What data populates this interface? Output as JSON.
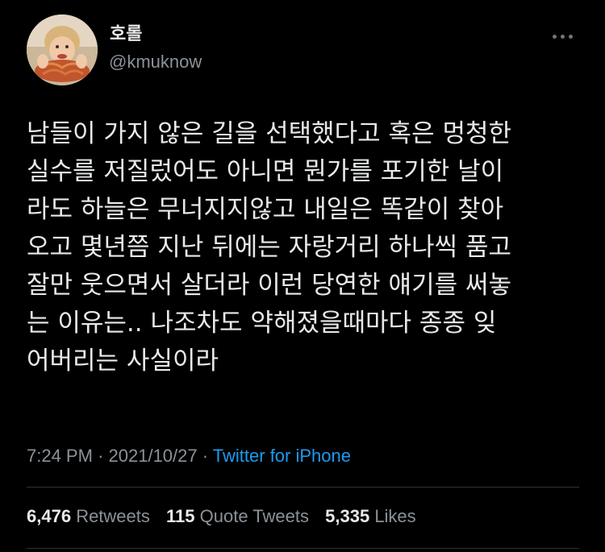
{
  "user": {
    "display_name": "호롤",
    "handle": "@kmuknow"
  },
  "tweet": {
    "lines": [
      "남들이 가지 않은 길을 선택했다고 혹은 멍청한",
      "실수를 저질렀어도 아니면 뭔가를 포기한 날이",
      "라도 하늘은 무너지지않고 내일은 똑같이 찾아",
      "오고 몇년쯤 지난 뒤에는 자랑거리 하나씩 품고",
      "잘만 웃으면서 살더라 이런 당연한 얘기를 써놓",
      "는 이유는.. 나조차도 약해졌을때마다 종종 잊",
      "어버리는 사실이라"
    ],
    "time": "7:24 PM",
    "date": "2021/10/27",
    "separator": "·",
    "source": "Twitter for iPhone"
  },
  "stats": {
    "retweets": {
      "count": "6,476",
      "label": "Retweets"
    },
    "quotes": {
      "count": "115",
      "label": "Quote Tweets"
    },
    "likes": {
      "count": "5,335",
      "label": "Likes"
    }
  },
  "icons": {
    "more": "more-options-icon"
  },
  "colors": {
    "background": "#000000",
    "text": "#e7e9ea",
    "secondary": "#8b9298",
    "link": "#1d9bf0",
    "divider": "#2f3336"
  }
}
